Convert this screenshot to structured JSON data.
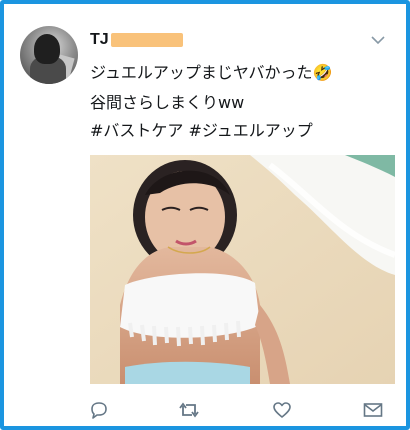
{
  "tweet": {
    "author_name": "TJ",
    "lines": [
      "ジュエルアップまじヤバかった🤣",
      "谷間さらしまくりww",
      "#バストケア #ジュエルアップ"
    ]
  },
  "icons": {
    "menu": "chevron-down-icon",
    "reply": "reply-icon",
    "retweet": "retweet-icon",
    "like": "heart-icon",
    "dm": "envelope-icon"
  },
  "colors": {
    "frame": "#1b95e0",
    "action_icon": "#657786",
    "redaction": "#f9c27a"
  }
}
